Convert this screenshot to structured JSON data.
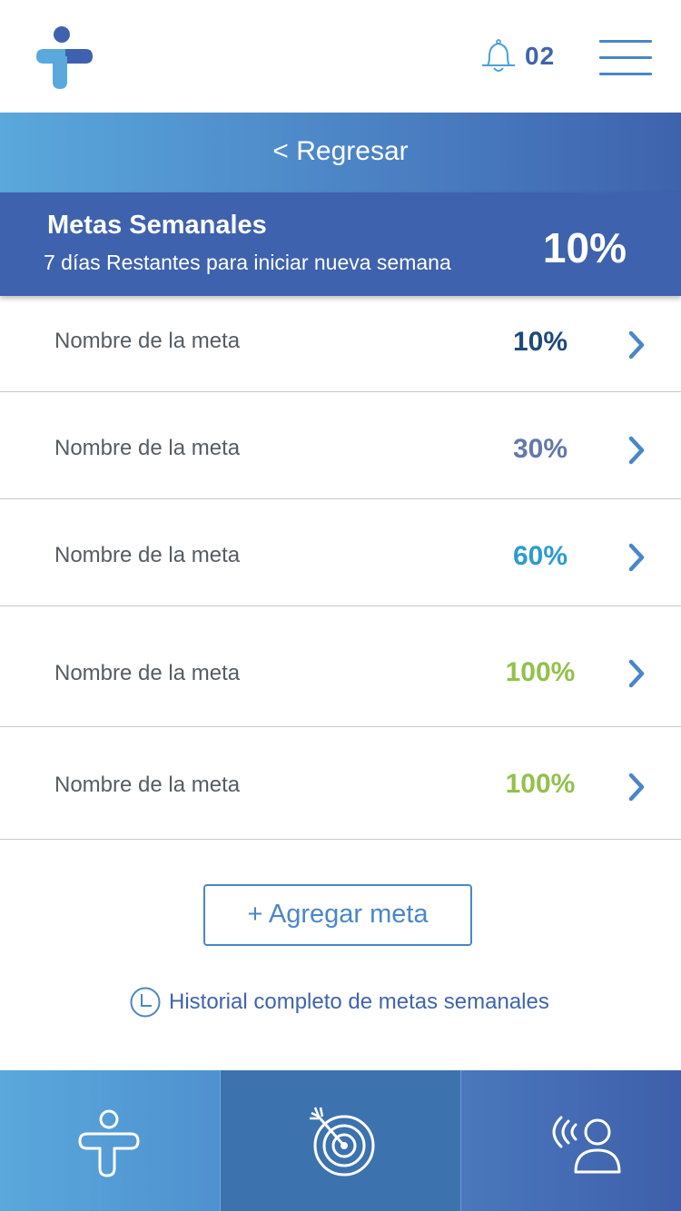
{
  "header": {
    "logo_icon": "app-logo",
    "notification_icon": "bell-icon",
    "notification_count": "02",
    "menu_icon": "hamburger-menu-icon"
  },
  "back": {
    "label": "< Regresar"
  },
  "weekly": {
    "title": "Metas Semanales",
    "subtitle": "7 días Restantes para iniciar nueva semana",
    "percent": "10%"
  },
  "goals": [
    {
      "name": "Nombre de la meta",
      "percent": "10%",
      "color": "#1e4a7a"
    },
    {
      "name": "Nombre de la meta",
      "percent": "30%",
      "color": "#6479a8"
    },
    {
      "name": "Nombre de la meta",
      "percent": "60%",
      "color": "#2d9bd0"
    },
    {
      "name": "Nombre de la meta",
      "percent": "100%",
      "color": "#93c04d"
    },
    {
      "name": "Nombre de la meta",
      "percent": "100%",
      "color": "#93c04d"
    }
  ],
  "actions": {
    "add_goal": "+ Agregar meta",
    "history": "Historial completo de metas semanales"
  },
  "nav": [
    {
      "name": "home",
      "icon": "person-plus-icon"
    },
    {
      "name": "goals",
      "icon": "target-icon",
      "active": true
    },
    {
      "name": "contact",
      "icon": "user-signal-icon"
    }
  ],
  "colors": {
    "brand_dark": "#3e62ad",
    "brand_light": "#5aa8dc",
    "accent": "#4a86c8"
  }
}
